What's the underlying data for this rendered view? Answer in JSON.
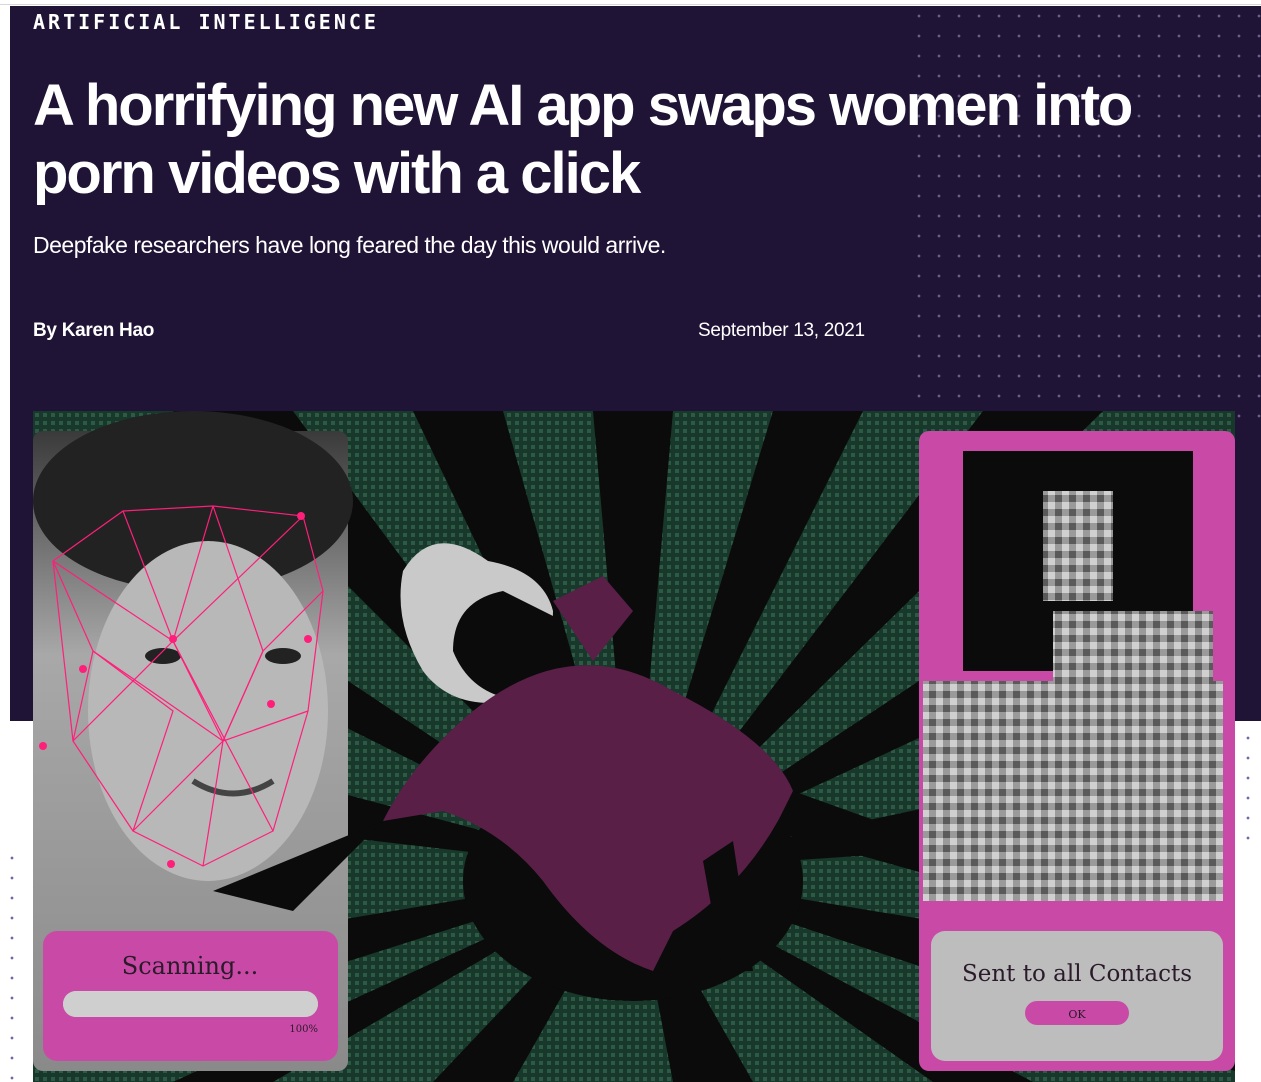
{
  "article": {
    "category": "ARTIFICIAL INTELLIGENCE",
    "headline": "A horrifying new AI app swaps women into porn videos with a click",
    "dek": "Deepfake researchers have long feared the day this would arrive.",
    "byline_prefix": "By",
    "author": "Karen Hao",
    "date": "September 13, 2021"
  },
  "illustration": {
    "scan_card": {
      "label": "Scanning...",
      "progress": 1.0,
      "progress_label": "100%"
    },
    "sent_card": {
      "label": "Sent to all Contacts",
      "button_label": "OK"
    }
  },
  "colors": {
    "hero_bg": "#1f1336",
    "accent_pink": "#c94aa6",
    "art_green": "#17382a",
    "figure_purple": "#5a1f47",
    "mesh_pink": "#ff1f7a"
  }
}
